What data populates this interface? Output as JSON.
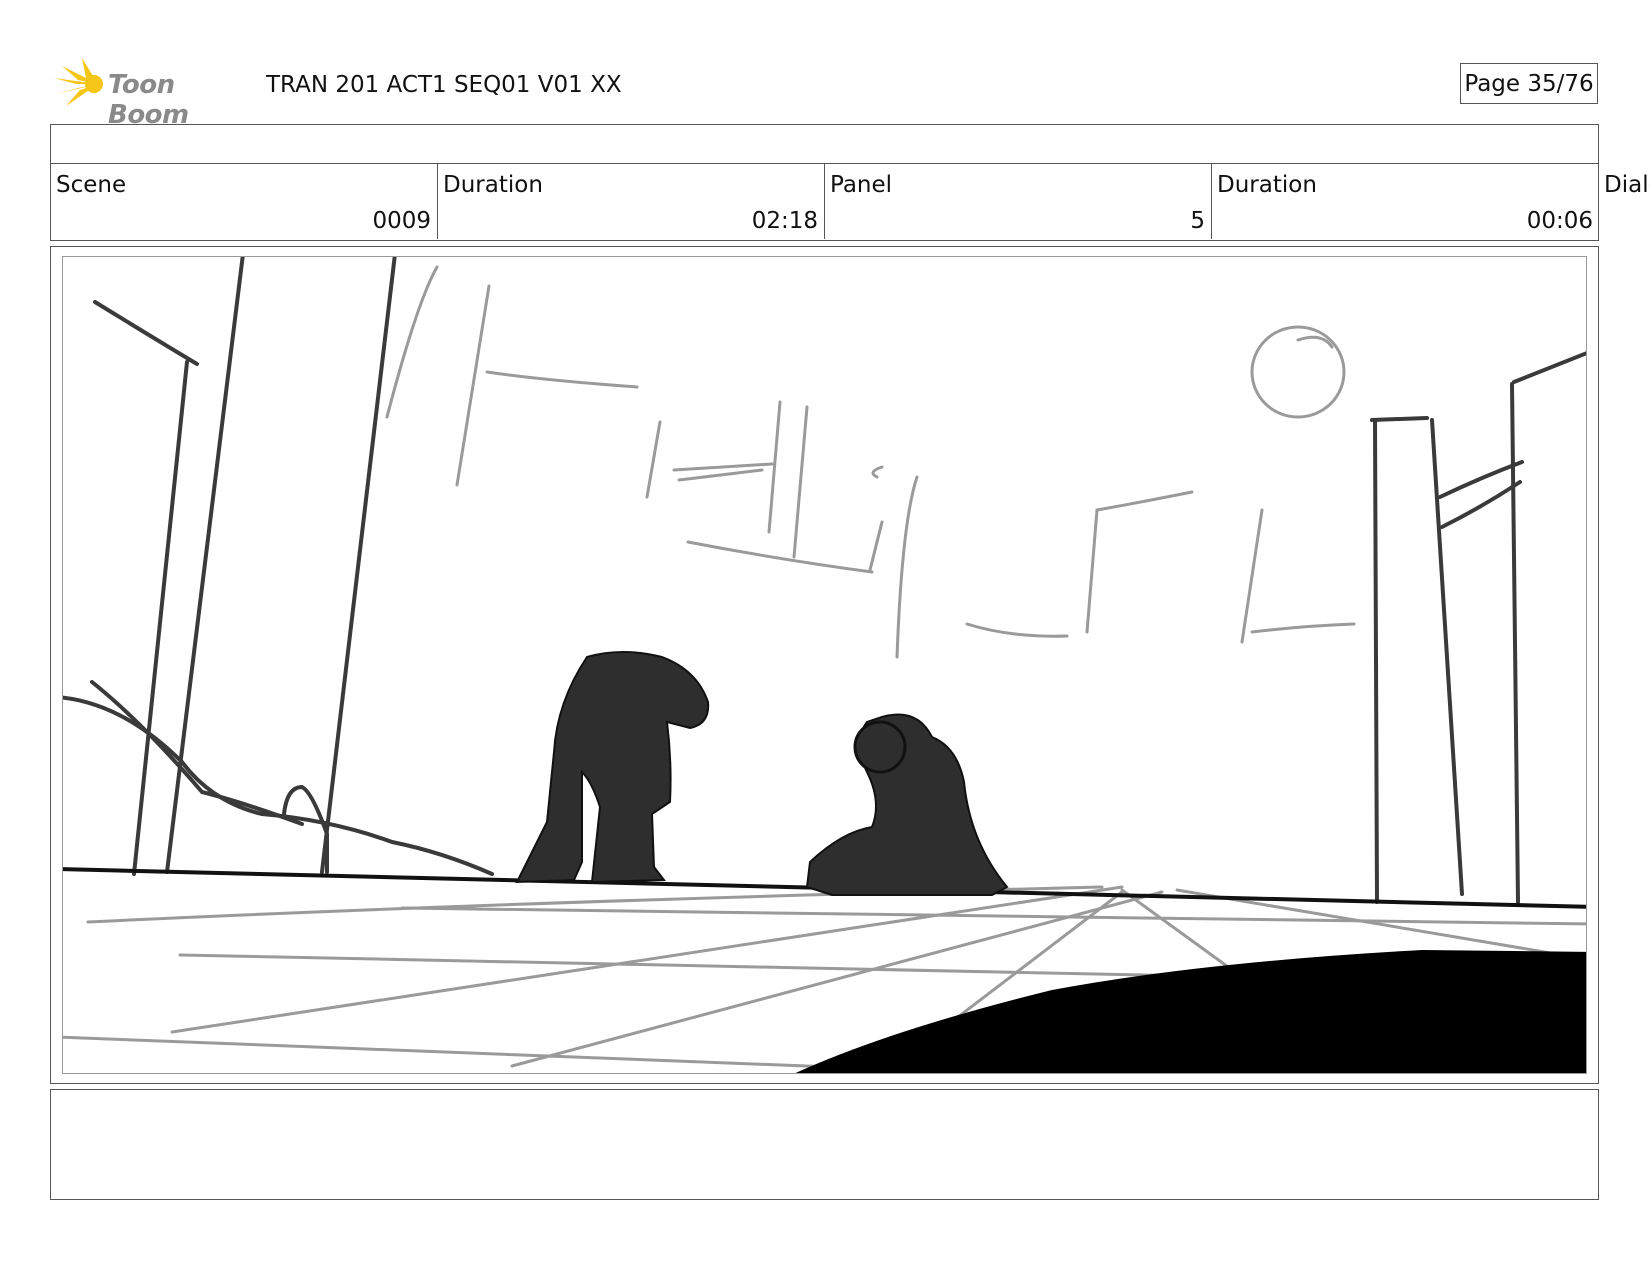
{
  "header": {
    "logo_text": "Toon Boom",
    "title": "TRAN 201 ACT1 SEQ01 V01 XX",
    "page": "Page 35/76"
  },
  "info": {
    "scene_label": "Scene",
    "scene_value": "0009",
    "scene_duration_label": "Duration",
    "scene_duration_value": "02:18",
    "panel_label": "Panel",
    "panel_value": "5",
    "panel_duration_label": "Duration",
    "panel_duration_value": "00:06",
    "dialog_label": "Dialo"
  },
  "colors": {
    "logo_star": "#f5c518",
    "logo_text": "#8a8a8a",
    "border": "#555555",
    "sketch_dark": "#2b2b2b",
    "sketch_light": "#9a9a9a"
  }
}
